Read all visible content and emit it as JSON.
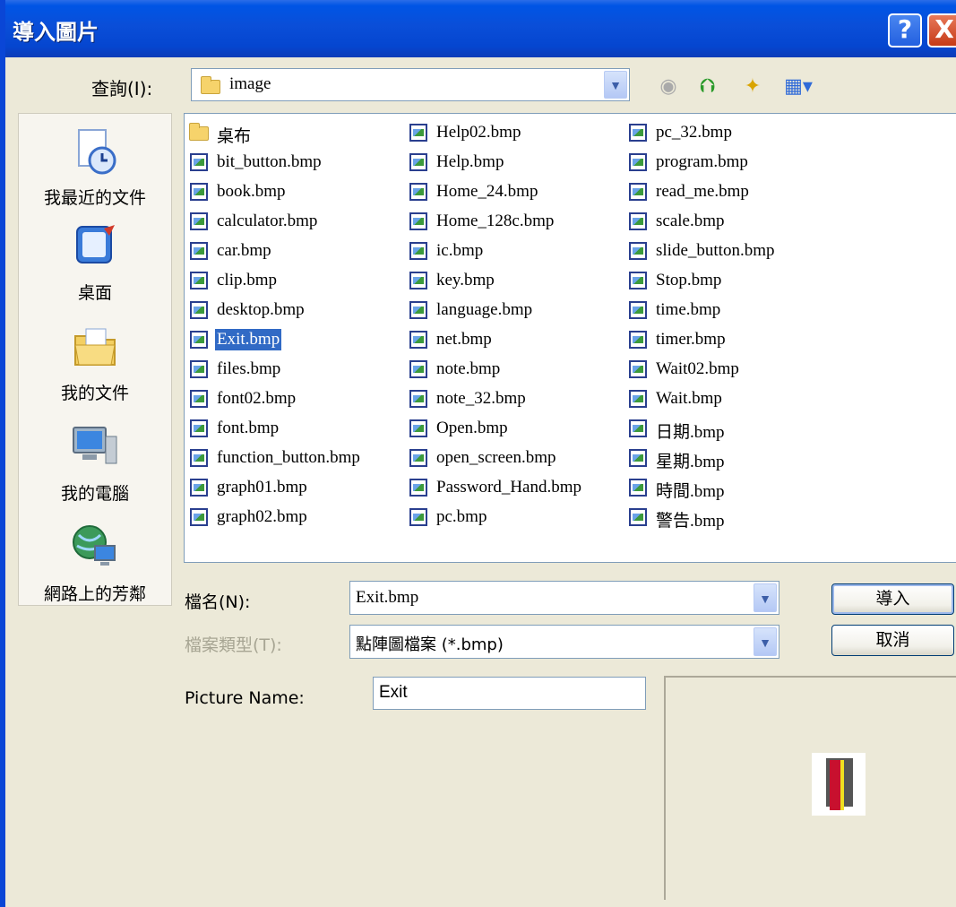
{
  "title": "導入圖片",
  "title_buttons": {
    "help": "?",
    "close": "X"
  },
  "look_in": {
    "label": "查詢(I):",
    "value": "image"
  },
  "places": [
    {
      "label": "我最近的文件",
      "icon": "recent-documents-icon"
    },
    {
      "label": "桌面",
      "icon": "desktop-icon"
    },
    {
      "label": "我的文件",
      "icon": "my-documents-icon"
    },
    {
      "label": "我的電腦",
      "icon": "my-computer-icon"
    },
    {
      "label": "網路上的芳鄰",
      "icon": "network-places-icon"
    }
  ],
  "files": {
    "col1": [
      "桌布",
      "bit_button.bmp",
      "book.bmp",
      "calculator.bmp",
      "car.bmp",
      "clip.bmp",
      "desktop.bmp",
      "Exit.bmp",
      "files.bmp",
      "font02.bmp",
      "font.bmp",
      "function_button.bmp",
      "graph01.bmp",
      "graph02.bmp"
    ],
    "col2": [
      "Help02.bmp",
      "Help.bmp",
      "Home_24.bmp",
      "Home_128c.bmp",
      "ic.bmp",
      "key.bmp",
      "language.bmp",
      "net.bmp",
      "note.bmp",
      "note_32.bmp",
      "Open.bmp",
      "open_screen.bmp",
      "Password_Hand.bmp",
      "pc.bmp"
    ],
    "col3": [
      "pc_32.bmp",
      "program.bmp",
      "read_me.bmp",
      "scale.bmp",
      "slide_button.bmp",
      "Stop.bmp",
      "time.bmp",
      "timer.bmp",
      "Wait02.bmp",
      "Wait.bmp",
      "日期.bmp",
      "星期.bmp",
      "時間.bmp",
      "警告.bmp"
    ],
    "selected": "Exit.bmp"
  },
  "file_name": {
    "label": "檔名(N):",
    "value": "Exit.bmp"
  },
  "file_type": {
    "label": "檔案類型(T):",
    "value": "點陣圖檔案 (*.bmp)"
  },
  "buttons": {
    "import": "導入",
    "cancel": "取消"
  },
  "picture_name": {
    "label": "Picture Name:",
    "value": "Exit"
  },
  "colors": {
    "title_bar": "#0a4ed8",
    "selection": "#316ac5",
    "window_bg": "#ece9d8"
  }
}
